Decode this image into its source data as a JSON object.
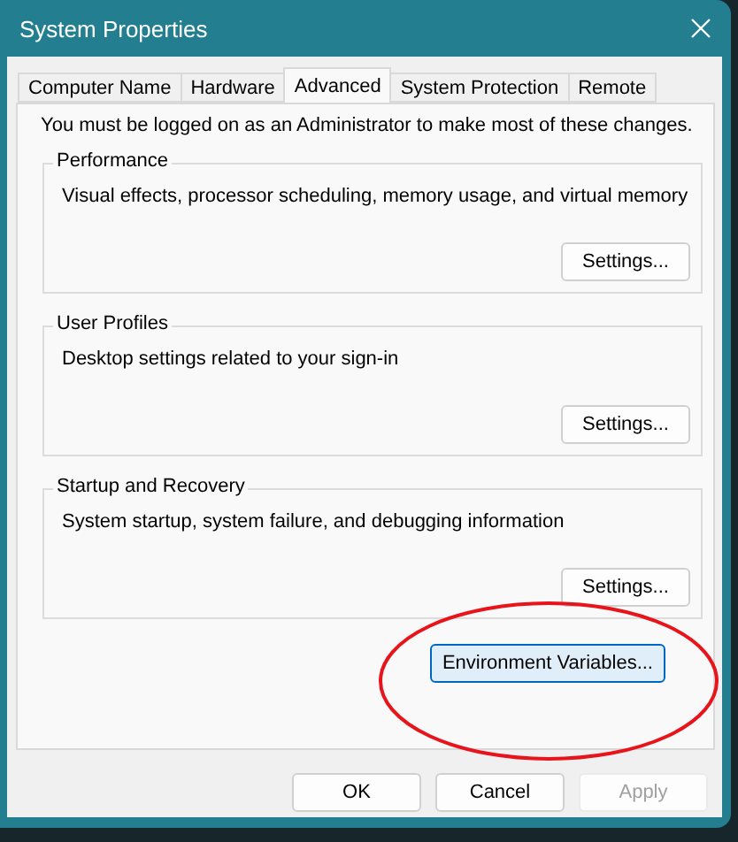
{
  "window": {
    "title": "System Properties"
  },
  "tabs": [
    {
      "label": "Computer Name",
      "selected": false
    },
    {
      "label": "Hardware",
      "selected": false
    },
    {
      "label": "Advanced",
      "selected": true
    },
    {
      "label": "System Protection",
      "selected": false
    },
    {
      "label": "Remote",
      "selected": false
    }
  ],
  "admin_note": "You must be logged on as an Administrator to make most of these changes.",
  "groups": [
    {
      "title": "Performance",
      "description": "Visual effects, processor scheduling, memory usage, and virtual memory",
      "button": "Settings..."
    },
    {
      "title": "User Profiles",
      "description": "Desktop settings related to your sign-in",
      "button": "Settings..."
    },
    {
      "title": "Startup and Recovery",
      "description": "System startup, system failure, and debugging information",
      "button": "Settings..."
    }
  ],
  "environment_button": {
    "label": "Environment Variables...",
    "default": true
  },
  "buttons": [
    {
      "label": "OK",
      "disabled": false
    },
    {
      "label": "Cancel",
      "disabled": false
    },
    {
      "label": "Apply",
      "disabled": true
    }
  ]
}
